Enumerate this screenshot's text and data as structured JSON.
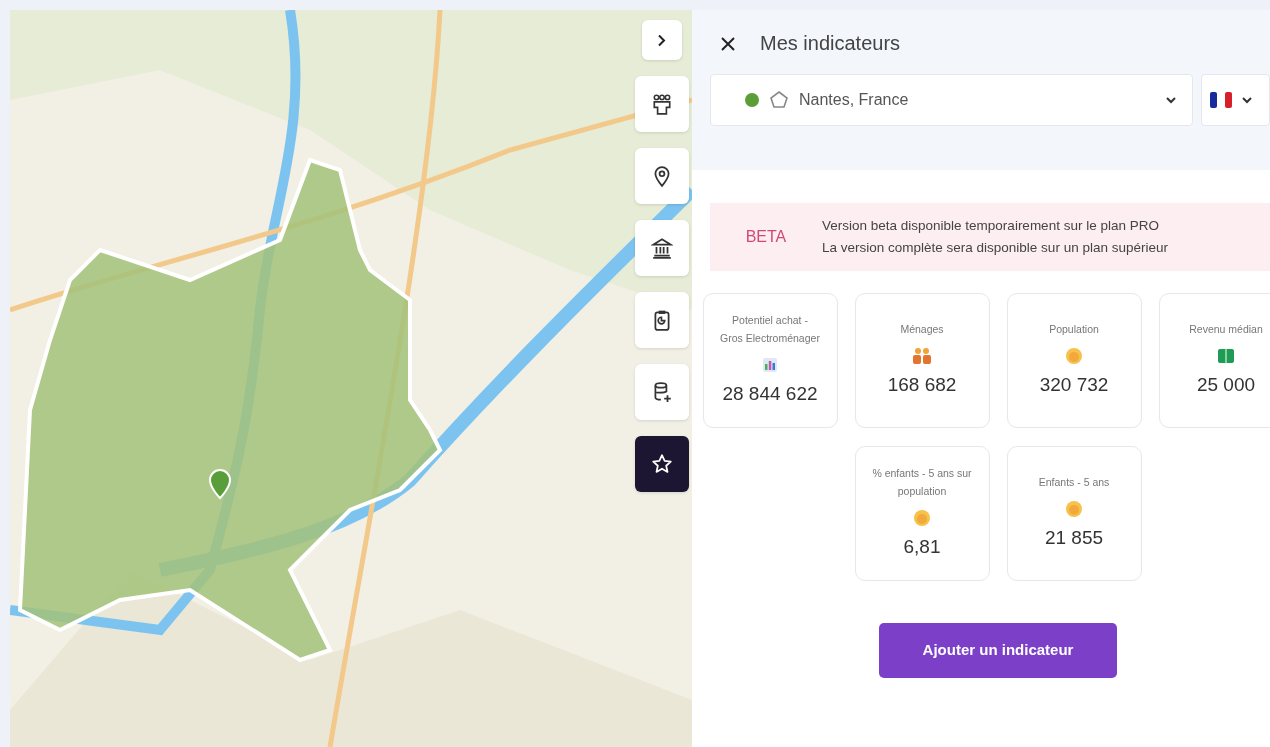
{
  "map_tools": [
    {
      "kind": "chevron",
      "selected": false
    },
    {
      "kind": "people",
      "selected": false
    },
    {
      "kind": "pin",
      "selected": false
    },
    {
      "kind": "bank",
      "selected": false
    },
    {
      "kind": "clipboard",
      "selected": false
    },
    {
      "kind": "database",
      "selected": false
    },
    {
      "kind": "star",
      "selected": true
    }
  ],
  "panel": {
    "title": "Mes indicateurs",
    "location": {
      "active": true,
      "value": "Nantes, France"
    }
  },
  "beta": {
    "badge": "BETA",
    "lines": [
      "Version beta disponible temporairement sur le plan PRO",
      "La version complète sera disponible sur un plan supérieur"
    ]
  },
  "indicator_rows": [
    [
      {
        "label": "Potentiel achat - Gros Electroménager",
        "kind": "chart",
        "value": "28 844 622"
      },
      {
        "label": "Ménages",
        "kind": "people",
        "value": "168 682"
      },
      {
        "label": "Population",
        "kind": "face",
        "value": "320 732"
      },
      {
        "label": "Revenu médian",
        "kind": "money",
        "value": "25 000"
      }
    ],
    [
      {
        "label": "% enfants - 5 ans sur population",
        "kind": "face",
        "value": "6,81"
      },
      {
        "label": "Enfants - 5 ans",
        "kind": "face",
        "value": "21 855"
      }
    ]
  ],
  "add_button": "Ajouter un indicateur"
}
